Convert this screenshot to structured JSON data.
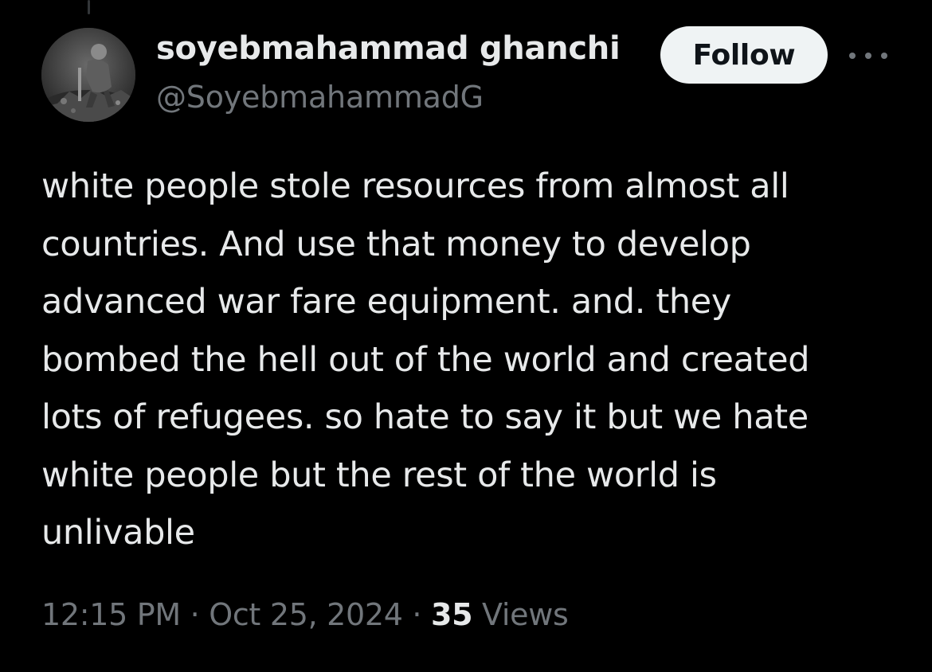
{
  "author": {
    "display_name": "soyebmahammad ghanchi",
    "handle": "@SoyebmahammadG",
    "avatar_icon": "avatar-photo"
  },
  "actions": {
    "follow_label": "Follow",
    "more_icon": "more-horizontal-icon"
  },
  "tweet": {
    "lines": [
      "white people stole resources from almost all",
      "countries. And use that money to develop",
      "advanced war fare equipment. and. they",
      "bombed the hell out of the world and created",
      "lots of refugees. so hate to say it but we hate",
      "white people but the rest of the world is",
      "unlivable"
    ]
  },
  "meta": {
    "time": "12:15 PM",
    "separator": "·",
    "date": "Oct 25, 2024",
    "views_count": "35",
    "views_label": "Views"
  },
  "colors": {
    "background": "#000000",
    "primary_text": "#e7e9ea",
    "secondary_text": "#71767b",
    "follow_button_bg": "#eff3f4",
    "follow_button_text": "#0f1419"
  }
}
